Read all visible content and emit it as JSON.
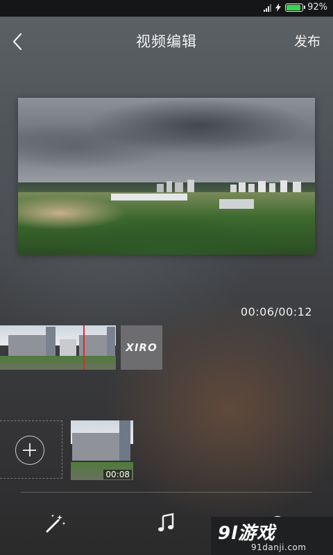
{
  "status_bar": {
    "battery_text": "92%",
    "battery_level": 0.92,
    "battery_color": "#37d64a"
  },
  "header": {
    "title": "视频编辑",
    "publish_label": "发布",
    "back_icon": "chevron-left-icon"
  },
  "player": {
    "timecode": "00:06/00:12"
  },
  "timeline": {
    "end_card_text": "XIRO",
    "playhead_color": "#e0282b"
  },
  "clips": {
    "add_icon": "plus-circle-icon",
    "items": [
      {
        "duration": "00:08"
      }
    ]
  },
  "toolbar": {
    "items": [
      {
        "icon": "magic-wand-icon"
      },
      {
        "icon": "music-note-icon"
      },
      {
        "icon": "settings-icon"
      }
    ]
  },
  "watermark": {
    "main": "9l游戏",
    "sub": "91danji.com"
  }
}
